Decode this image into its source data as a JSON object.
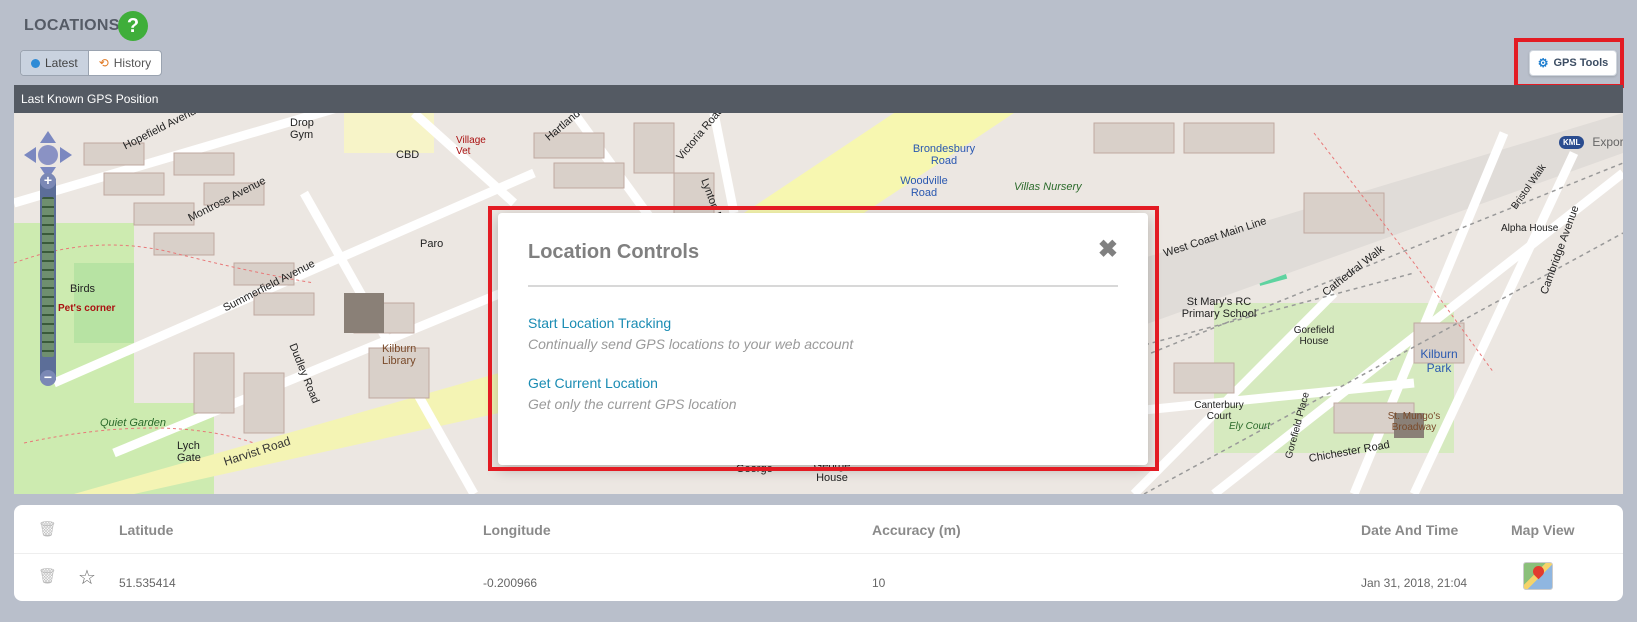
{
  "page": {
    "title": "LOCATIONS",
    "help_icon": "question-icon"
  },
  "view_toggle": {
    "latest_label": "Latest",
    "history_label": "History",
    "selected": "Latest"
  },
  "toolbar": {
    "gps_tools_label": "GPS Tools",
    "gps_tools_icon": "gear-icon"
  },
  "map": {
    "header": "Last Known GPS Position",
    "kml_badge": "KML",
    "export_label": "Export",
    "labels": {
      "hopefield": "Hopefield Avenue",
      "montrose": "Montrose Avenue",
      "summerfield": "Summerfield Avenue",
      "dudley": "Dudley Road",
      "harvist": "Harvist Road",
      "birds": "Birds",
      "pets_corner": "Pet's corner",
      "quiet_garden": "Quiet Garden",
      "lych_gate": "Lych Gate",
      "drop_gym": "Drop Gym",
      "cbd": "CBD",
      "village_vet": "Village Vet",
      "paro": "Paro",
      "kilburn_library": "Kilburn Library",
      "hartland": "Hartland Road",
      "victoria": "Victoria Road",
      "lynton": "Lynton Road",
      "brondesbury": "Brondesbury Road",
      "woodville": "Woodville Road",
      "villas_nursery": "Villas Nursery",
      "west_coast": "West Coast Main Line",
      "st_marys": "St Mary's RC Primary School",
      "cathedral_walk": "Cathedral Walk",
      "gorefield_house": "Gorefield House",
      "kilburn_park": "Kilburn Park",
      "alpha_house": "Alpha House",
      "bristol_walk": "Bristol Walk",
      "cambridge_ave": "Cambridge Avenue",
      "canterbury_court": "Canterbury Court",
      "ely_court": "Ely Court",
      "st_mungos": "St. Mungo's Broadway",
      "chichester": "Chichester Road",
      "gorefield_place": "Gorefield Place",
      "george": "George",
      "george_house": "George House"
    }
  },
  "modal": {
    "title": "Location Controls",
    "close_icon": "close-icon",
    "start_tracking_label": "Start Location Tracking",
    "start_tracking_desc": "Continually send GPS locations to your web account",
    "get_current_label": "Get Current Location",
    "get_current_desc": "Get only the current GPS location"
  },
  "table": {
    "headers": {
      "latitude": "Latitude",
      "longitude": "Longitude",
      "accuracy": "Accuracy (m)",
      "datetime": "Date And Time",
      "mapview": "Map View"
    },
    "rows": [
      {
        "latitude": "51.535414",
        "longitude": "-0.200966",
        "accuracy": "10",
        "datetime": "Jan 31, 2018, 21:04"
      }
    ]
  },
  "colors": {
    "highlight": "#e31b23",
    "link": "#1a8cb3",
    "help": "#3fae3a",
    "header_bar": "#545a63"
  }
}
